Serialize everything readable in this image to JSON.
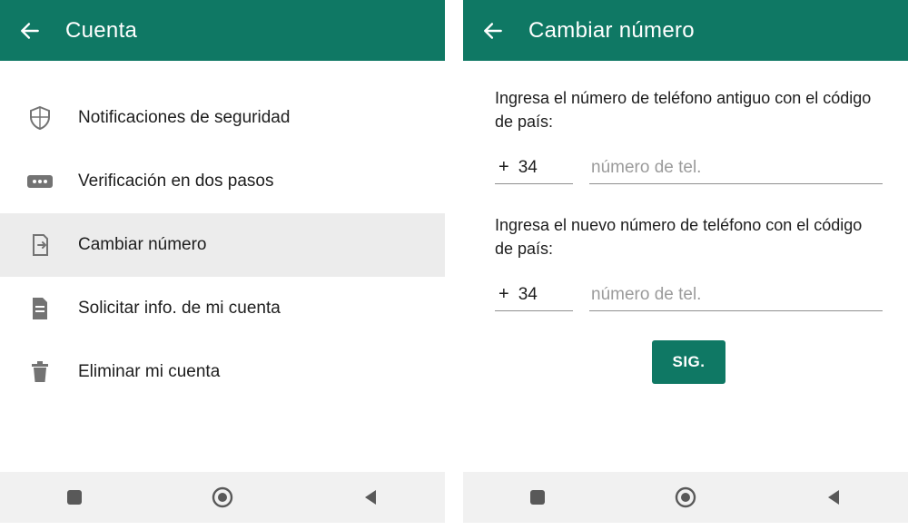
{
  "colors": {
    "primary": "#0f7864",
    "muted": "#737373",
    "text": "#1d1d1d",
    "placeholder": "#9b9b9b",
    "highlight": "#ececec"
  },
  "left": {
    "header": {
      "title": "Cuenta"
    },
    "items": [
      {
        "label": "Notificaciones de seguridad",
        "icon": "shield-icon",
        "active": false
      },
      {
        "label": "Verificación en dos pasos",
        "icon": "dots-icon",
        "active": false
      },
      {
        "label": "Cambiar número",
        "icon": "swap-sim-icon",
        "active": true
      },
      {
        "label": "Solicitar info. de mi cuenta",
        "icon": "doc-icon",
        "active": false
      },
      {
        "label": "Eliminar mi cuenta",
        "icon": "trash-icon",
        "active": false
      }
    ]
  },
  "right": {
    "header": {
      "title": "Cambiar número"
    },
    "prompt_old": "Ingresa el número de teléfono antiguo con el código de país:",
    "prompt_new": "Ingresa el nuevo número de teléfono con el código de país:",
    "plus": "+",
    "cc_old": "34",
    "cc_new": "34",
    "phone_placeholder": "número de tel.",
    "next_label": "SIG."
  }
}
